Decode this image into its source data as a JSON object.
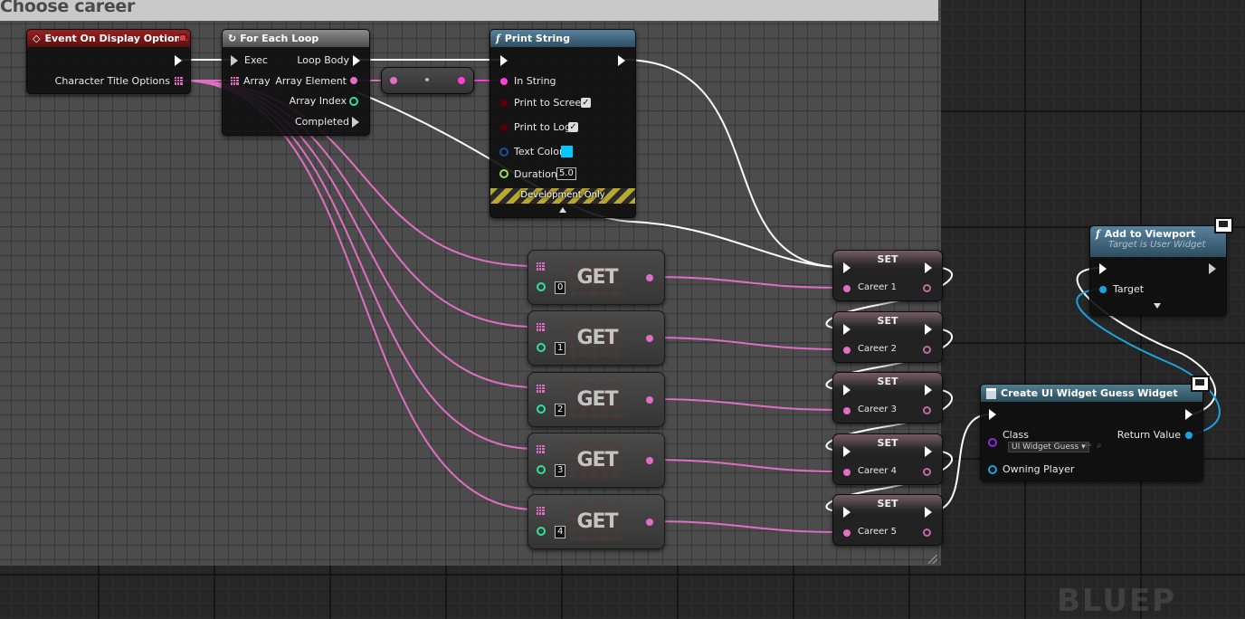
{
  "comment": {
    "title": "Choose career"
  },
  "event_node": {
    "title": "Event On Display Options",
    "pin_character_title_options": "Character Title Options"
  },
  "foreach_node": {
    "title": "For Each Loop",
    "pin_exec": "Exec",
    "pin_array": "Array",
    "pin_loop_body": "Loop Body",
    "pin_array_element": "Array Element",
    "pin_array_index": "Array Index",
    "pin_completed": "Completed"
  },
  "print_node": {
    "title": "Print String",
    "pin_in_string": "In String",
    "pin_print_to_screen": "Print to Screen",
    "pin_print_to_log": "Print to Log",
    "pin_text_color": "Text Color",
    "text_color_value": "#00c8ff",
    "pin_duration": "Duration",
    "duration_value": "5.0",
    "footer": "Development Only",
    "print_to_screen_checked": true,
    "print_to_log_checked": true
  },
  "get_nodes": [
    {
      "label": "GET",
      "index": "0"
    },
    {
      "label": "GET",
      "index": "1"
    },
    {
      "label": "GET",
      "index": "2"
    },
    {
      "label": "GET",
      "index": "3"
    },
    {
      "label": "GET",
      "index": "4"
    }
  ],
  "set_nodes": [
    {
      "label": "SET",
      "var": "Career 1"
    },
    {
      "label": "SET",
      "var": "Career 2"
    },
    {
      "label": "SET",
      "var": "Career 3"
    },
    {
      "label": "SET",
      "var": "Career 4"
    },
    {
      "label": "SET",
      "var": "Career 5"
    }
  ],
  "viewport_node": {
    "title": "Add to Viewport",
    "subtitle": "Target is User Widget",
    "pin_target": "Target"
  },
  "widget_node": {
    "title": "Create UI Widget Guess Widget",
    "pin_class": "Class",
    "class_value": "UI Widget Guess",
    "pin_owning_player": "Owning Player",
    "pin_return_value": "Return Value"
  },
  "colors": {
    "exec": "#ffffff",
    "array_pin": "#e06fc4",
    "string_pin": "#ff3fd8",
    "int_pin": "#2fe0a0",
    "object_pin": "#1ba5e0",
    "class_pin": "#8a2be2",
    "event_header": "#9a2020",
    "function_header": "#57829e"
  },
  "corner_watermark": "BLUEP"
}
